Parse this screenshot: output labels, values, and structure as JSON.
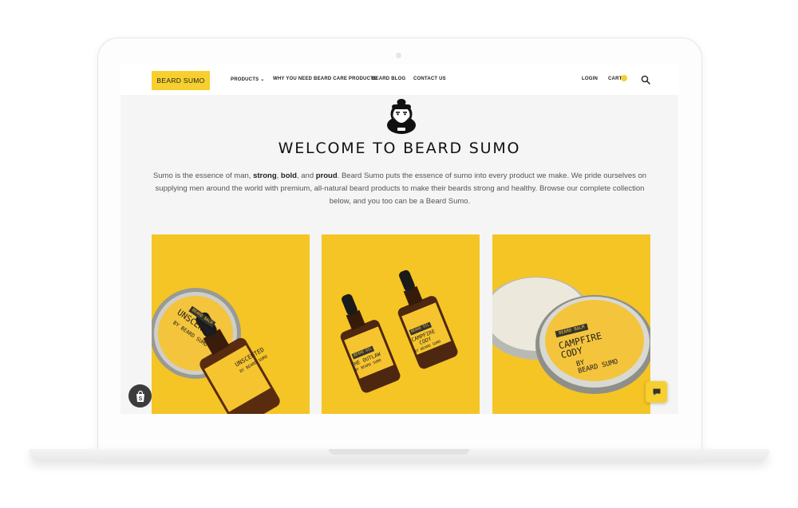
{
  "brand": {
    "logo_text": "BEARD SUMO",
    "accent": "#f7cf2e"
  },
  "nav": {
    "items": [
      {
        "label": "PRODUCTS",
        "has_dropdown": true,
        "icon": "chevron-down-icon"
      },
      {
        "label": "WHY YOU NEED BEARD CARE PRODUCTS"
      },
      {
        "label": "BEARD BLOG"
      },
      {
        "label": "CONTACT US"
      }
    ],
    "login": "LOGIN",
    "cart": "CART",
    "search_icon": "search-icon"
  },
  "hero": {
    "title": "WELCOME TO BEARD SUMO",
    "intro_before": "Sumo is the essence of man, ",
    "word_strong": "strong",
    "sep1": ", ",
    "word_bold": "bold",
    "sep2": ", and ",
    "word_proud": "proud",
    "intro_after": ". Beard Sumo puts the essence of sumo into every product we make. We pride ourselves on supplying men around the world with premium, all-natural beard products to make their beards strong and healthy. Browse our complete collection below, and you too can be a Beard Sumo."
  },
  "products": {
    "p1": {
      "tin_tag": "BEARD BALM",
      "tin_name": "UNSCENTED",
      "tin_by": "BY BEARD SUMO",
      "bottle_name": "UNSCENTED",
      "bottle_by": "BY BEARD SUMO"
    },
    "p2": {
      "left_tag": "BEARD OIL",
      "left_name": "THE OUTLAW",
      "left_by": "BY BEARD SUMO",
      "right_tag": "BEARD OIL",
      "right_name": "CAMPFIRE CODY",
      "right_by": "BY BEARD SUMO"
    },
    "p3": {
      "tag": "BEARD BALM",
      "name_line1": "CAMPFIRE",
      "name_line2": "CODY",
      "by_line1": "BY",
      "by_line2": "BEARD SUMO"
    }
  },
  "icons": {
    "shopify": "shopify-bag-icon",
    "chat": "chat-icon",
    "mascot": "sumo-mascot-icon"
  }
}
